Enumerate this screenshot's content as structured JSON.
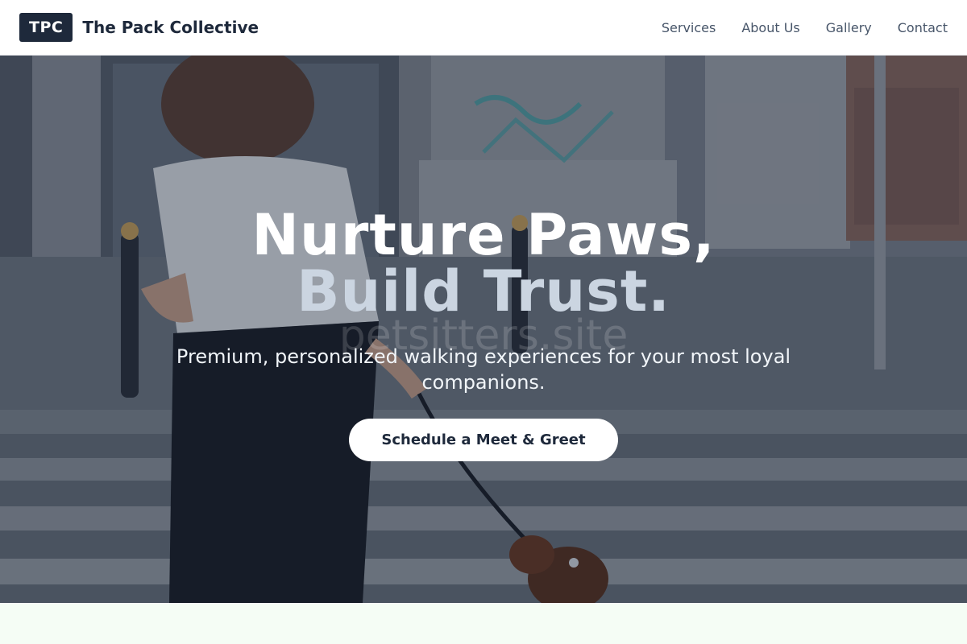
{
  "header": {
    "logo_badge": "TPC",
    "brand_name": "The Pack Collective",
    "nav": [
      "Services",
      "About Us",
      "Gallery",
      "Contact"
    ]
  },
  "hero": {
    "title_line1": "Nurture Paws,",
    "title_line2": "Build Trust.",
    "watermark": "petsitters.site",
    "subtitle": "Premium, personalized walking experiences for your most loyal companions.",
    "cta_label": "Schedule a Meet & Greet",
    "background_image": "woman walking small dog on leash across street crosswalk"
  },
  "colors": {
    "brand_dark": "#1e293b",
    "nav_text": "#475569",
    "title_accent": "#cbd5e1",
    "next_section_bg": "#f5fdf5"
  }
}
